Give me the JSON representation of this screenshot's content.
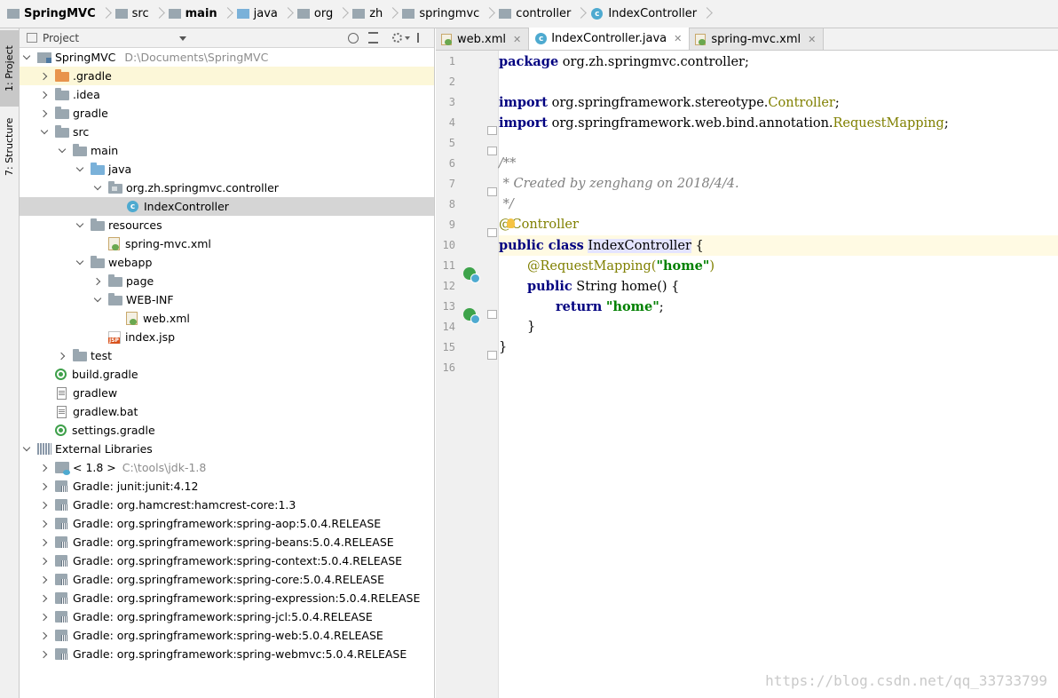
{
  "breadcrumb": [
    "SpringMVC",
    "src",
    "main",
    "java",
    "org",
    "zh",
    "springmvc",
    "controller",
    "IndexController"
  ],
  "toolstrip": {
    "project_tab": "1: Project",
    "structure_tab": "7: Structure"
  },
  "project_panel": {
    "header_label": "Project",
    "root": {
      "name": "SpringMVC",
      "path": "D:\\Documents\\SpringMVC"
    },
    "items": {
      "gradle_dir": ".gradle",
      "idea": ".idea",
      "gradle": "gradle",
      "src": "src",
      "main": "main",
      "java": "java",
      "pkg": "org.zh.springmvc.controller",
      "index_controller": "IndexController",
      "resources": "resources",
      "spring_mvc_xml": "spring-mvc.xml",
      "webapp": "webapp",
      "page": "page",
      "web_inf": "WEB-INF",
      "web_xml": "web.xml",
      "index_jsp": "index.jsp",
      "test": "test",
      "build_gradle": "build.gradle",
      "gradlew": "gradlew",
      "gradlew_bat": "gradlew.bat",
      "settings_gradle": "settings.gradle",
      "external_libraries": "External Libraries",
      "jdk": "< 1.8 >",
      "jdk_path": "C:\\tools\\jdk-1.8"
    },
    "libraries": [
      "Gradle: junit:junit:4.12",
      "Gradle: org.hamcrest:hamcrest-core:1.3",
      "Gradle: org.springframework:spring-aop:5.0.4.RELEASE",
      "Gradle: org.springframework:spring-beans:5.0.4.RELEASE",
      "Gradle: org.springframework:spring-context:5.0.4.RELEASE",
      "Gradle: org.springframework:spring-core:5.0.4.RELEASE",
      "Gradle: org.springframework:spring-expression:5.0.4.RELEASE",
      "Gradle: org.springframework:spring-jcl:5.0.4.RELEASE",
      "Gradle: org.springframework:spring-web:5.0.4.RELEASE",
      "Gradle: org.springframework:spring-webmvc:5.0.4.RELEASE"
    ]
  },
  "editor": {
    "tabs": [
      "web.xml",
      "IndexController.java",
      "spring-mvc.xml"
    ],
    "line_numbers": [
      "1",
      "2",
      "3",
      "4",
      "5",
      "6",
      "7",
      "8",
      "9",
      "10",
      "11",
      "12",
      "13",
      "14",
      "15",
      "16"
    ],
    "code": {
      "l1_kw": "package",
      "l1_rest": " org.zh.springmvc.controller;",
      "l3_kw": "import",
      "l3_rest": " org.springframework.stereotype.",
      "l3_cls": "Controller",
      "l3_end": ";",
      "l4_kw": "import",
      "l4_rest": " org.springframework.web.bind.annotation.",
      "l4_cls": "RequestMapping",
      "l4_end": ";",
      "l6": "/**",
      "l7": " * Created by zenghang on 2018/4/4.",
      "l8": " */",
      "l9": "@Controller",
      "l10_kw": "public class",
      "l10_cls": "IndexController",
      "l10_end": " {",
      "l11_ann": "@RequestMapping(",
      "l11_str": "\"home\"",
      "l11_end": ")",
      "l12_kw": "public",
      "l12_rest": " String home() {",
      "l13_kw": "return",
      "l13_str": "\"home\"",
      "l13_end": ";",
      "l14": "}",
      "l15": "}"
    }
  },
  "watermark": "https://blog.csdn.net/qq_33733799"
}
